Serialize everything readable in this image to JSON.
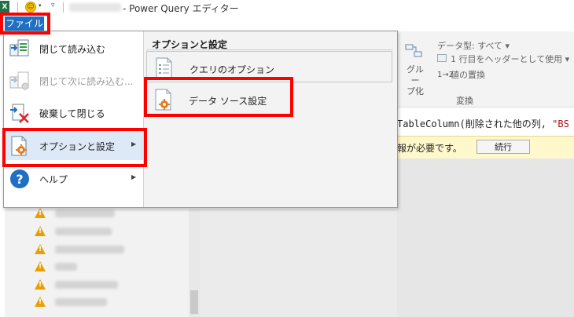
{
  "titlebar": {
    "excel_icon": "X",
    "title": "- Power Query エディター",
    "dropdown_glyph": "▾"
  },
  "file_tab": {
    "label": "ファイル"
  },
  "file_menu": {
    "items": [
      {
        "label": "閉じて読み込む",
        "icon": "close-load-icon",
        "disabled": false
      },
      {
        "label": "閉じて次に読み込む...",
        "icon": "close-load-to-icon",
        "disabled": true
      },
      {
        "label": "破棄して閉じる",
        "icon": "discard-close-icon",
        "disabled": false
      },
      {
        "label": "オプションと設定",
        "icon": "options-settings-icon",
        "disabled": false,
        "has_submenu": true
      },
      {
        "label": "ヘルプ",
        "icon": "help-icon",
        "disabled": false,
        "has_submenu": true
      }
    ],
    "submenu": {
      "title": "オプションと設定",
      "items": [
        {
          "label": "クエリのオプション",
          "icon": "query-options-icon"
        },
        {
          "label": "データ ソース設定",
          "icon": "data-source-settings-icon"
        }
      ]
    }
  },
  "ribbon": {
    "group_label": "グループ化",
    "group_label_line1": "グルー",
    "group_label_line2": "プ化",
    "data_type": "データ型: すべて ▾",
    "use_first_row": "1 行目をヘッダーとして使用 ▾",
    "replace_values": "値の置換",
    "replace_prefix": "1→2",
    "group_caption": "変換"
  },
  "formula": {
    "text_prefix": "TableColumn(削除された他の列, ",
    "text_string": "\"BS"
  },
  "warning": {
    "text": "報が必要です。",
    "continue_label": "続行"
  },
  "colors": {
    "file_tab_blue": "#1f6fc4",
    "highlight_red": "#ff0000",
    "warning_yellow": "#fff8cc"
  }
}
